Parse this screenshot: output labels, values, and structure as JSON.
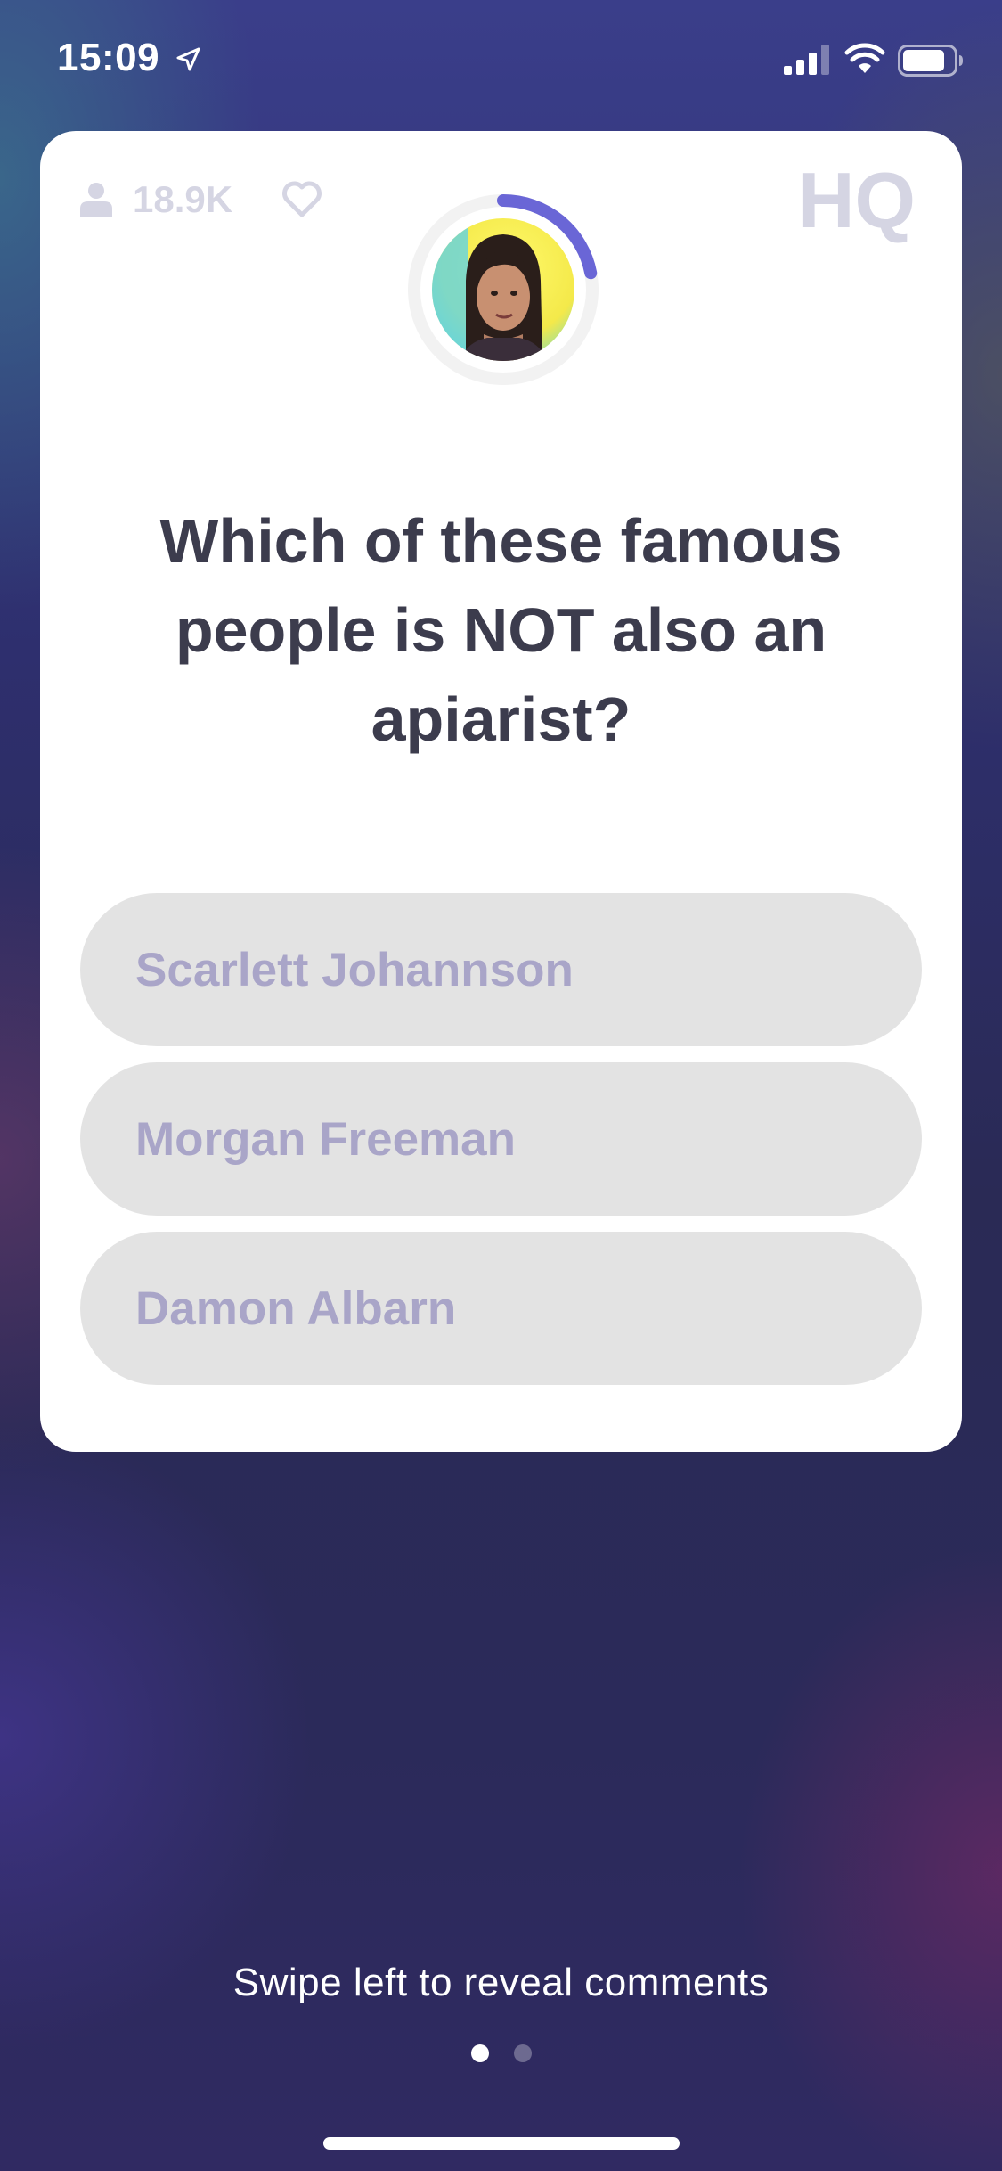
{
  "status_bar": {
    "time": "15:09",
    "icons": [
      "location-arrow-icon",
      "cellular-signal-icon",
      "wifi-icon",
      "battery-icon"
    ]
  },
  "card": {
    "viewer_count": "18.9K",
    "logo_text": "HQ",
    "timer_progress": 0.22,
    "question": "Which of these famous people is NOT also an apiarist?",
    "answers": [
      {
        "label": "Scarlett Johannson"
      },
      {
        "label": "Morgan Freeman"
      },
      {
        "label": "Damon Albarn"
      }
    ]
  },
  "footer": {
    "swipe_hint": "Swipe left to reveal comments",
    "page_count": 2,
    "current_page": 1
  },
  "colors": {
    "timer_arc": "#6a66d6",
    "answer_bg": "#e3e3e3",
    "answer_text": "#a9a5c8",
    "question_text": "#3c3c4d",
    "muted_icon": "#d5d5e3"
  }
}
